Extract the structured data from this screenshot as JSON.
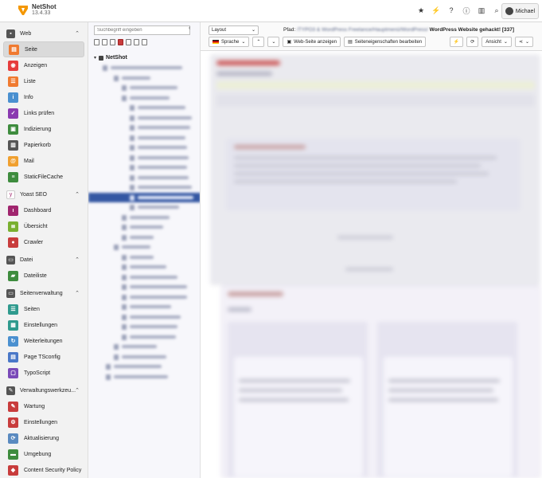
{
  "app": {
    "name": "NetShot",
    "version": "13.4.33"
  },
  "topbar": {
    "icons": [
      "star-icon",
      "bolt-icon",
      "help-icon",
      "info-icon",
      "grid-icon",
      "search-icon"
    ],
    "user": "Michael"
  },
  "modules": [
    {
      "type": "group",
      "label": "Web",
      "icon": "web-icon",
      "color": "#555555",
      "glyph": "▪"
    },
    {
      "type": "item",
      "label": "Seite",
      "icon": "page-icon",
      "color": "#f07a30",
      "glyph": "▤",
      "active": true
    },
    {
      "type": "item",
      "label": "Anzeigen",
      "icon": "eye-icon",
      "color": "#e63c3c",
      "glyph": "◉"
    },
    {
      "type": "item",
      "label": "Liste",
      "icon": "list-icon",
      "color": "#f07a30",
      "glyph": "☰"
    },
    {
      "type": "item",
      "label": "Info",
      "icon": "info-icon",
      "color": "#4a90d0",
      "glyph": "i"
    },
    {
      "type": "item",
      "label": "Links prüfen",
      "icon": "link-check-icon",
      "color": "#8a3ab0",
      "glyph": "✓"
    },
    {
      "type": "item",
      "label": "Indizierung",
      "icon": "index-icon",
      "color": "#3e8c3e",
      "glyph": "▣"
    },
    {
      "type": "item",
      "label": "Papierkorb",
      "icon": "trash-icon",
      "color": "#555555",
      "glyph": "▥"
    },
    {
      "type": "item",
      "label": "Mail",
      "icon": "mail-icon",
      "color": "#f0a030",
      "glyph": "@"
    },
    {
      "type": "item",
      "label": "StaticFileCache",
      "icon": "cache-icon",
      "color": "#3e8c3e",
      "glyph": "≡"
    },
    {
      "type": "group",
      "label": "Yoast SEO",
      "icon": "yoast-icon",
      "color": "#ffffff",
      "glyph": "y",
      "glyph_color": "#a0256e"
    },
    {
      "type": "item",
      "label": "Dashboard",
      "icon": "dashboard-icon",
      "color": "#a0256e",
      "glyph": "ı"
    },
    {
      "type": "item",
      "label": "Übersicht",
      "icon": "overview-icon",
      "color": "#7ab030",
      "glyph": "≣"
    },
    {
      "type": "item",
      "label": "Crawler",
      "icon": "crawler-icon",
      "color": "#c83c3c",
      "glyph": "●"
    },
    {
      "type": "group",
      "label": "Datei",
      "icon": "file-group-icon",
      "color": "#555555",
      "glyph": "▭"
    },
    {
      "type": "item",
      "label": "Dateiliste",
      "icon": "filelist-icon",
      "color": "#3e8c3e",
      "glyph": "▰"
    },
    {
      "type": "group",
      "label": "Seitenverwaltung",
      "icon": "sitemanagement-icon",
      "color": "#555555",
      "glyph": "▭"
    },
    {
      "type": "item",
      "label": "Seiten",
      "icon": "sites-icon",
      "color": "#2f9a8e",
      "glyph": "☰"
    },
    {
      "type": "item",
      "label": "Einstellungen",
      "icon": "site-settings-icon",
      "color": "#2f9a8e",
      "glyph": "▦"
    },
    {
      "type": "item",
      "label": "Weiterleitungen",
      "icon": "redirects-icon",
      "color": "#4a90d0",
      "glyph": "↻"
    },
    {
      "type": "item",
      "label": "Page TSconfig",
      "icon": "tsconfig-icon",
      "color": "#4a78c8",
      "glyph": "▤"
    },
    {
      "type": "item",
      "label": "TypoScript",
      "icon": "typoscript-icon",
      "color": "#7a4ab8",
      "glyph": "▢"
    },
    {
      "type": "group",
      "label": "Verwaltungswerkzeu...",
      "icon": "admin-tools-icon",
      "color": "#555555",
      "glyph": "✎"
    },
    {
      "type": "item",
      "label": "Wartung",
      "icon": "maintenance-icon",
      "color": "#c83c3c",
      "glyph": "✎"
    },
    {
      "type": "item",
      "label": "Einstellungen",
      "icon": "settings-icon",
      "color": "#c83c3c",
      "glyph": "⚙"
    },
    {
      "type": "item",
      "label": "Aktualisierung",
      "icon": "upgrade-icon",
      "color": "#5a8ac0",
      "glyph": "⟳"
    },
    {
      "type": "item",
      "label": "Umgebung",
      "icon": "environment-icon",
      "color": "#3e8c3e",
      "glyph": "▬"
    },
    {
      "type": "item",
      "label": "Content Security Policy",
      "icon": "csp-icon",
      "color": "#c83c3c",
      "glyph": "◆"
    }
  ],
  "pagetree": {
    "search_placeholder": "Suchbegriff eingeben",
    "root_label": "NetShot"
  },
  "docheader": {
    "layout_select": "Layout",
    "path_label": "Pfad:",
    "path_blurred": "/TYPO3 & WordPress Freelance/Hauptmenü/WordPress/",
    "page_title": "WordPress Website gehackt!",
    "page_id": "[337]",
    "language_button": "Sprache",
    "view_button": "Web-Seite anzeigen",
    "properties_button": "Seiteneigenschaften bearbeiten",
    "view_dropdown": "Ansicht"
  }
}
